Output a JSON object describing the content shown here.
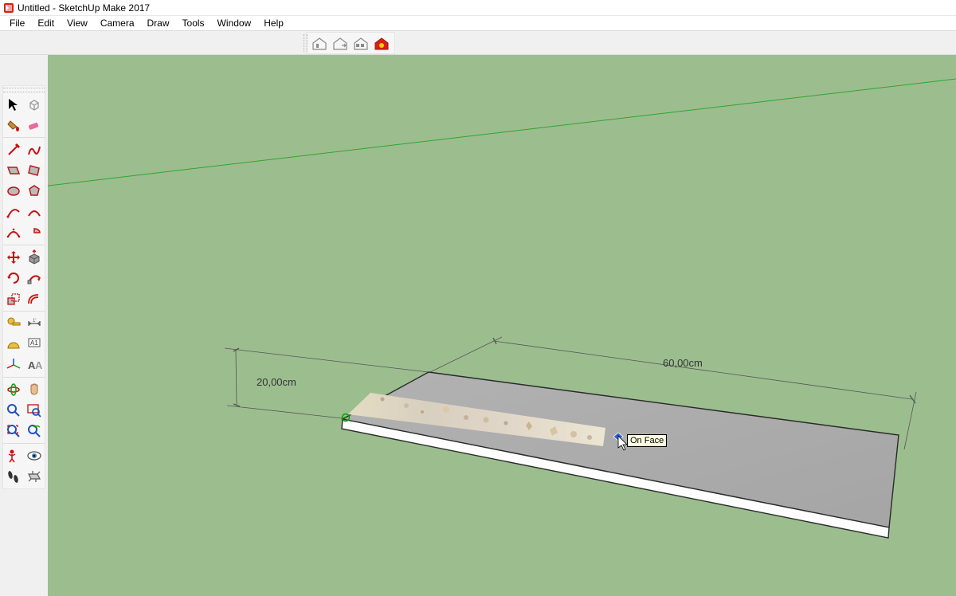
{
  "window": {
    "title": "Untitled - SketchUp Make 2017"
  },
  "menu": {
    "items": [
      "File",
      "Edit",
      "View",
      "Camera",
      "Draw",
      "Tools",
      "Window",
      "Help"
    ]
  },
  "toolbar_top": {
    "items": [
      "warehouse-icon",
      "warehouse-share-icon",
      "warehouse-components-icon",
      "extension-warehouse-icon"
    ]
  },
  "tooltip": {
    "text": "On Face"
  },
  "dimensions": {
    "left": "20,00cm",
    "right": "60,00cm"
  },
  "tools": {
    "group1": [
      "select-tool",
      "make-component-tool",
      "paint-bucket-tool",
      "eraser-tool"
    ],
    "group2": [
      "line-tool",
      "freehand-tool",
      "rectangle-tool",
      "rotated-rectangle-tool",
      "circle-tool",
      "polygon-tool",
      "arc-tool",
      "two-point-arc-tool",
      "three-point-arc-tool",
      "pie-tool"
    ],
    "group3": [
      "move-tool",
      "push-pull-tool",
      "rotate-tool",
      "follow-me-tool",
      "scale-tool",
      "offset-tool"
    ],
    "group4": [
      "tape-measure-tool",
      "dimension-tool",
      "protractor-tool",
      "text-tool",
      "axes-tool",
      "3d-text-tool"
    ],
    "group5": [
      "orbit-tool",
      "pan-tool",
      "zoom-tool",
      "zoom-window-tool",
      "zoom-extents-tool",
      "previous-view-tool"
    ],
    "group6": [
      "position-camera-tool",
      "look-around-tool",
      "walk-tool",
      "section-plane-tool"
    ]
  }
}
